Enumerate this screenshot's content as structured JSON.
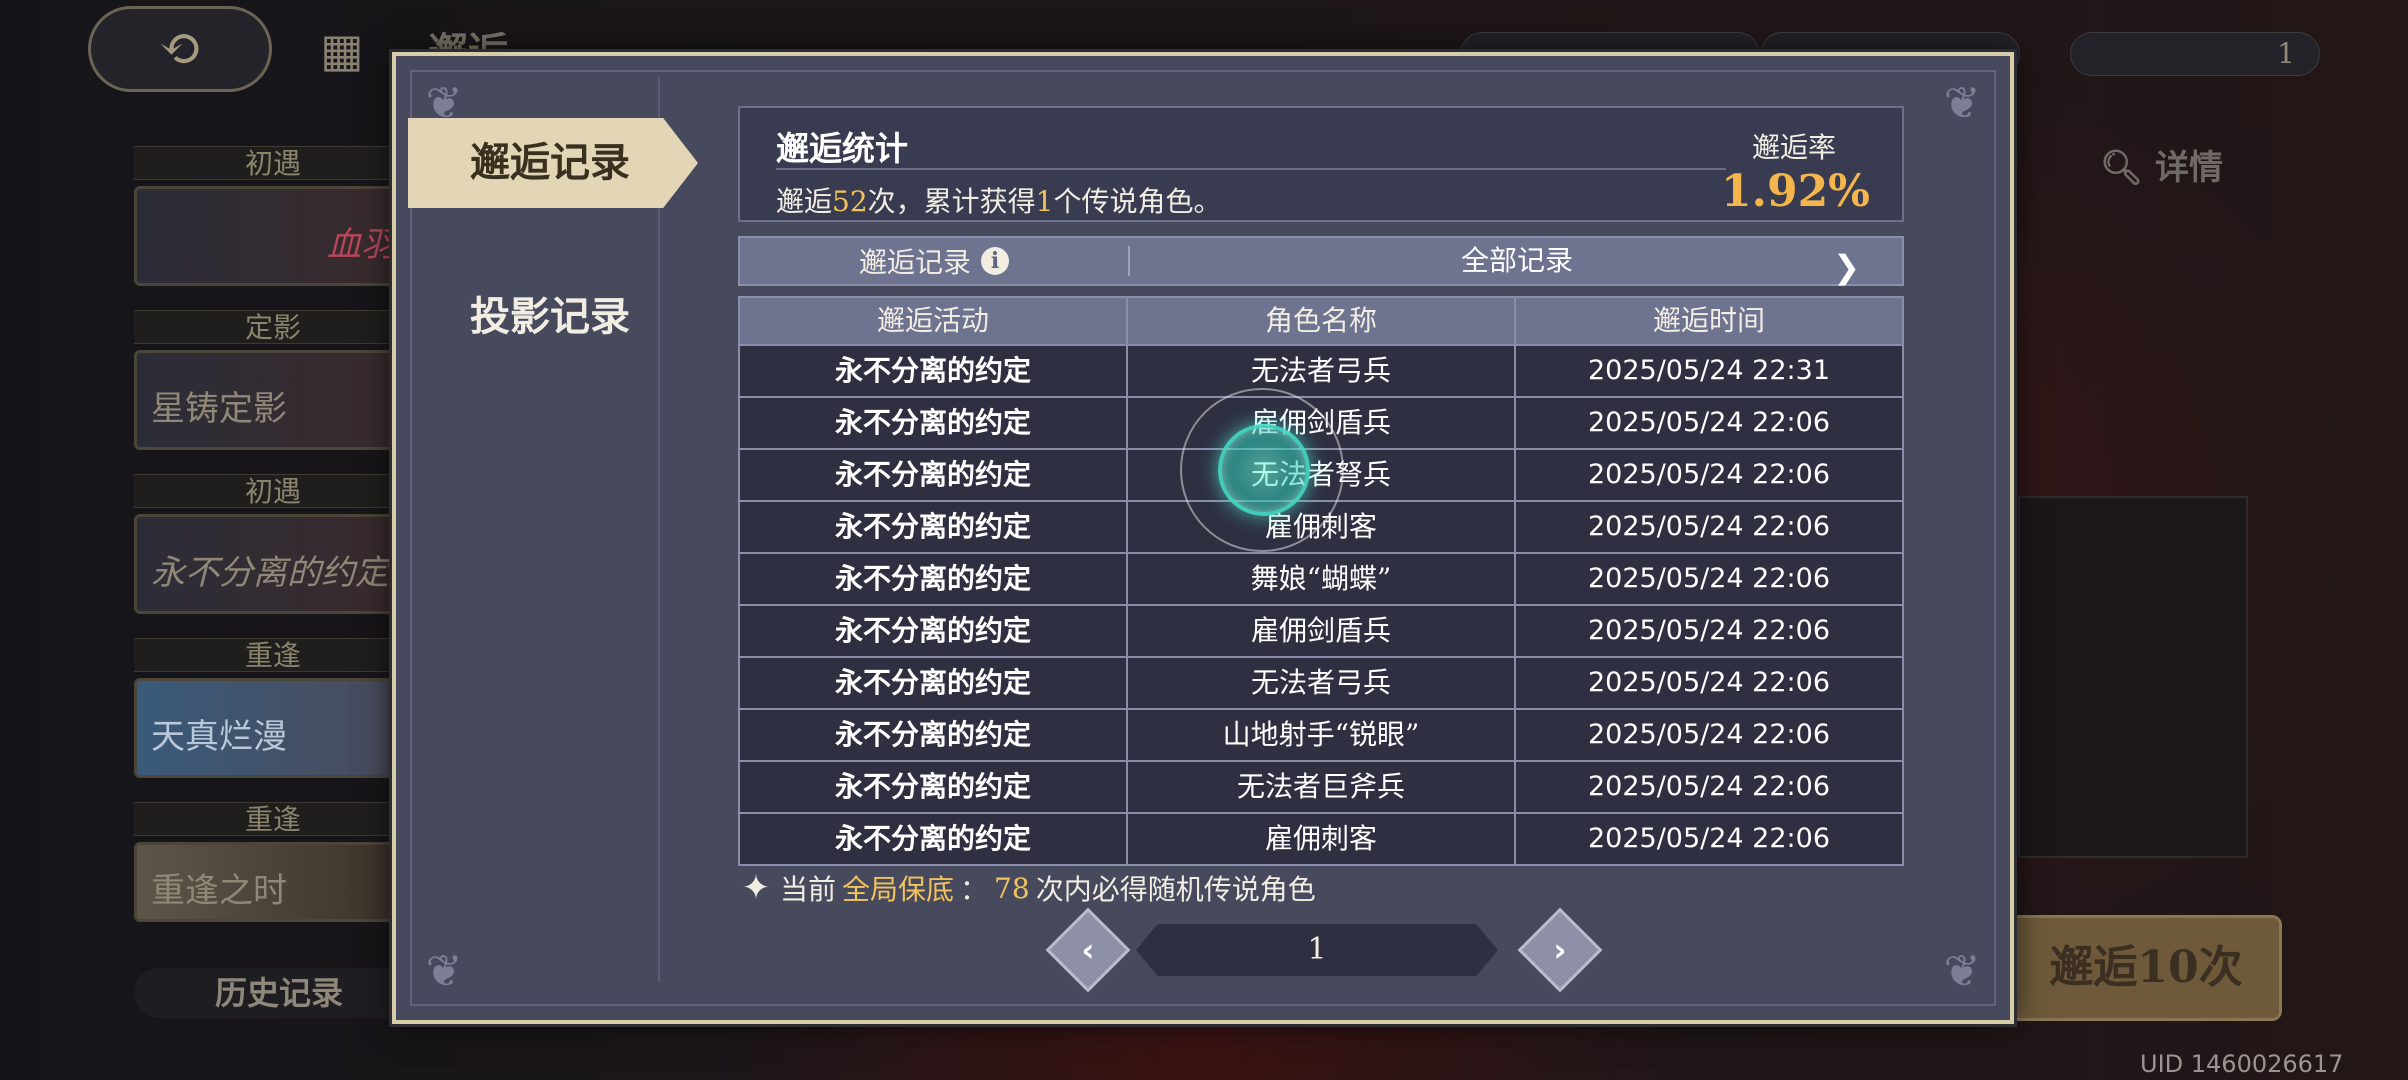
{
  "background": {
    "back_icon": "⟲",
    "menu_icon": "▦",
    "title": "邂逅",
    "currency_3": "1",
    "side_banners": [
      {
        "tag": "初遇",
        "label": "血羽"
      },
      {
        "tag": "定影",
        "label": "星铸定影"
      },
      {
        "tag": "初遇",
        "label": "永不分离的约定"
      },
      {
        "tag": "重逢",
        "label": "天真烂漫"
      },
      {
        "tag": "重逢",
        "label": "重逢之时"
      }
    ],
    "history_button": "历史记录",
    "detail_button": "详情",
    "pull10_button": "邂逅10次",
    "uid": "UID 1460026617"
  },
  "tabs": {
    "encounter_records": "邂逅记录",
    "projection_records": "投影记录"
  },
  "stats": {
    "title": "邂逅统计",
    "line_prefix": "邂逅",
    "pulls": "52",
    "line_mid": "次，累计获得",
    "legendary_count": "1",
    "line_suffix": "个传说角色。",
    "rate_label": "邂逅率",
    "rate_value": "1.92%"
  },
  "filter": {
    "left_label": "邂逅记录",
    "info_icon": "i",
    "right_label": "全部记录",
    "arrow": "❯"
  },
  "table": {
    "headers": [
      "邂逅活动",
      "角色名称",
      "邂逅时间"
    ],
    "rows": [
      [
        "永不分离的约定",
        "无法者弓兵",
        "2025/05/24 22:31"
      ],
      [
        "永不分离的约定",
        "雇佣剑盾兵",
        "2025/05/24 22:06"
      ],
      [
        "永不分离的约定",
        "无法者弩兵",
        "2025/05/24 22:06"
      ],
      [
        "永不分离的约定",
        "雇佣刺客",
        "2025/05/24 22:06"
      ],
      [
        "永不分离的约定",
        "舞娘“蝴蝶”",
        "2025/05/24 22:06"
      ],
      [
        "永不分离的约定",
        "雇佣剑盾兵",
        "2025/05/24 22:06"
      ],
      [
        "永不分离的约定",
        "无法者弓兵",
        "2025/05/24 22:06"
      ],
      [
        "永不分离的约定",
        "山地射手“锐眼”",
        "2025/05/24 22:06"
      ],
      [
        "永不分离的约定",
        "无法者巨斧兵",
        "2025/05/24 22:06"
      ],
      [
        "永不分离的约定",
        "雇佣刺客",
        "2025/05/24 22:06"
      ]
    ]
  },
  "pity": {
    "prefix": "当前",
    "highlight": "全局保底",
    "colon": "：",
    "count": "78",
    "suffix": "次内必得随机传说角色"
  },
  "pagination": {
    "prev": "‹",
    "page": "1",
    "next": "›"
  },
  "colors": {
    "gold": "#f2c25d",
    "rate": "#f4b64c",
    "frame": "#d7cda9",
    "panel": "#47495d"
  }
}
